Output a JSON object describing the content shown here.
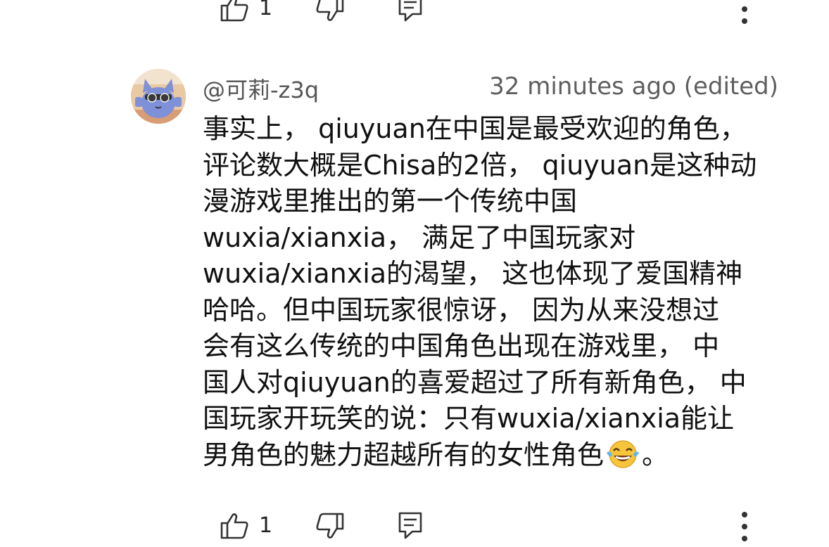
{
  "top_actions": {
    "like_count": "1"
  },
  "comment": {
    "author": "@可莉-z3q",
    "timestamp": "32 minutes ago (edited)",
    "lines": [
      "事实上，  qiuyuan在中国是最受欢迎的角色，",
      "评论数大概是Chisa的2倍，  qiuyuan是这种动",
      "漫游戏里推出的第一个传统中国",
      "wuxia/xianxia，  满足了中国玩家对",
      "wuxia/xianxia的渴望，  这也体现了爱国精神",
      "哈哈。但中国玩家很惊讶，  因为从来没想过",
      "会有这么传统的中国角色出现在游戏里，  中",
      "国人对qiuyuan的喜爱超过了所有新角色，  中",
      "国玩家开玩笑的说：只有wuxia/xianxia能让"
    ],
    "last_line_before_emoji": "男角色的魅力超越所有的女性角色",
    "last_line_after_emoji": "。",
    "emoji_name": "tears-of-joy-emoji",
    "like_count": "1"
  },
  "colors": {
    "background": "#ffffff",
    "text": "#111111",
    "meta_text": "#5e5e5e",
    "icon": "#333333"
  }
}
